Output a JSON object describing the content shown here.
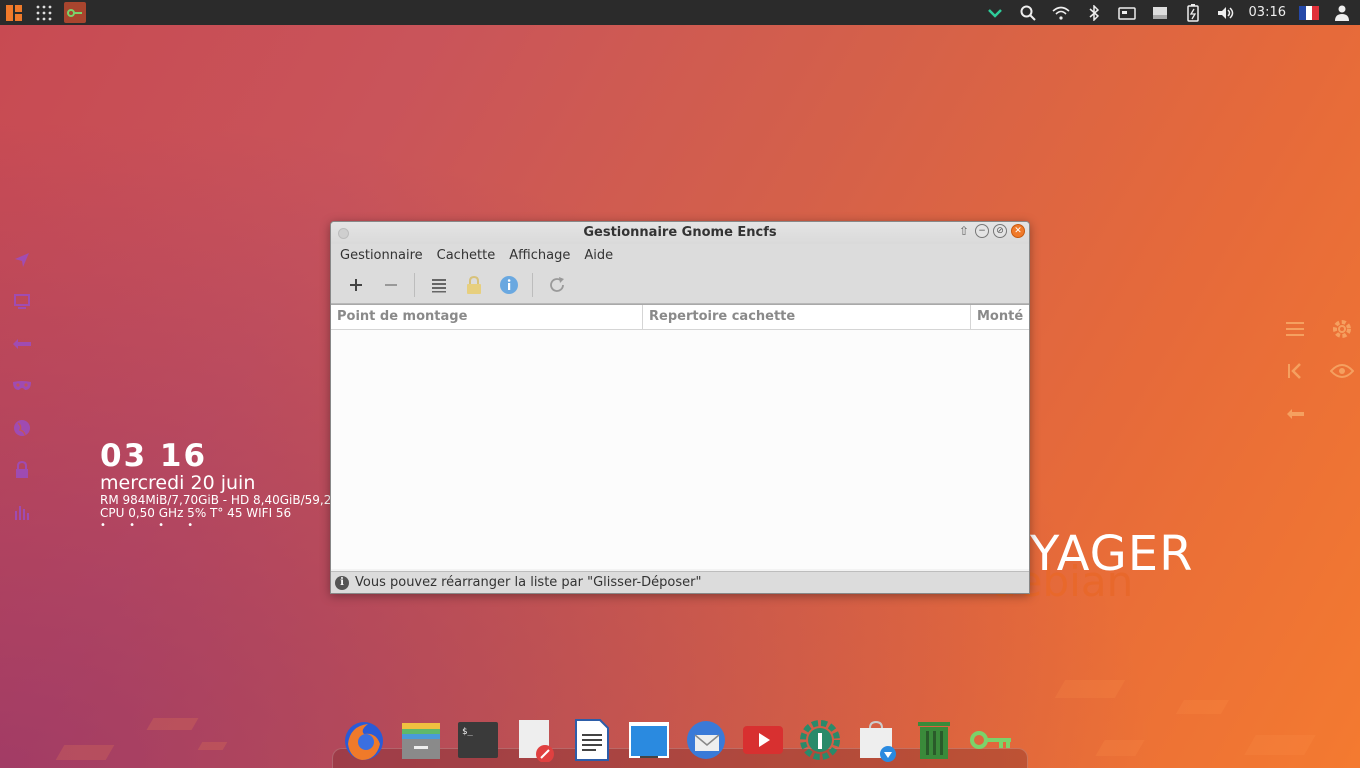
{
  "top_panel": {
    "clock": "03:16",
    "icons": [
      "apps-menu-icon",
      "grid-icon",
      "encfs-app-icon",
      "checkmark-icon",
      "search-icon",
      "wifi-icon",
      "bluetooth-icon",
      "removable-drive-icon",
      "keyboard-icon",
      "battery-icon",
      "volume-icon",
      "french-flag-icon",
      "user-icon"
    ]
  },
  "desktop": {
    "conky": {
      "time": "03 16",
      "date": "mercredi 20 juin",
      "stats_line1": "RM 984MiB/7,70GiB - HD 8,40GiB/59,2",
      "stats_line2": "CPU 0,50 GHz 5% T° 45  WIFI 56",
      "dots": "• • • •"
    },
    "brand": {
      "voyager": "YAGER",
      "debian": "debian"
    },
    "left_dock_icons": [
      "airplane-icon",
      "monitor-icon",
      "arrow-left-icon",
      "mask-icon",
      "globe-icon",
      "lock-icon",
      "bar-chart-icon"
    ],
    "right_dock_icons": [
      "hamburger-menu-icon",
      "gear-icon",
      "skip-back-icon",
      "eye-icon",
      "arrow-left-icon"
    ]
  },
  "window": {
    "title": "Gestionnaire Gnome Encfs",
    "menu": [
      "Gestionnaire",
      "Cachette",
      "Affichage",
      "Aide"
    ],
    "toolbar": [
      "add-icon",
      "remove-icon",
      "list-icon",
      "lock-icon",
      "info-icon",
      "refresh-icon"
    ],
    "table": {
      "columns": [
        "Point de montage",
        "Repertoire cachette",
        "Monté"
      ],
      "rows": []
    },
    "status": "Vous pouvez réarranger la liste par \"Glisser-Déposer\""
  },
  "dock": {
    "apps": [
      "firefox-icon",
      "file-manager-icon",
      "terminal-icon",
      "text-editor-icon",
      "writer-document-icon",
      "window-icon",
      "thunderbird-icon",
      "youtube-icon",
      "system-settings-icon",
      "software-install-icon",
      "trash-icon",
      "encfs-key-icon"
    ]
  },
  "colors": {
    "accent": "#f07a2a",
    "sidebar_icon": "#9a4dc8",
    "panel_bg": "#2b2b2b"
  }
}
